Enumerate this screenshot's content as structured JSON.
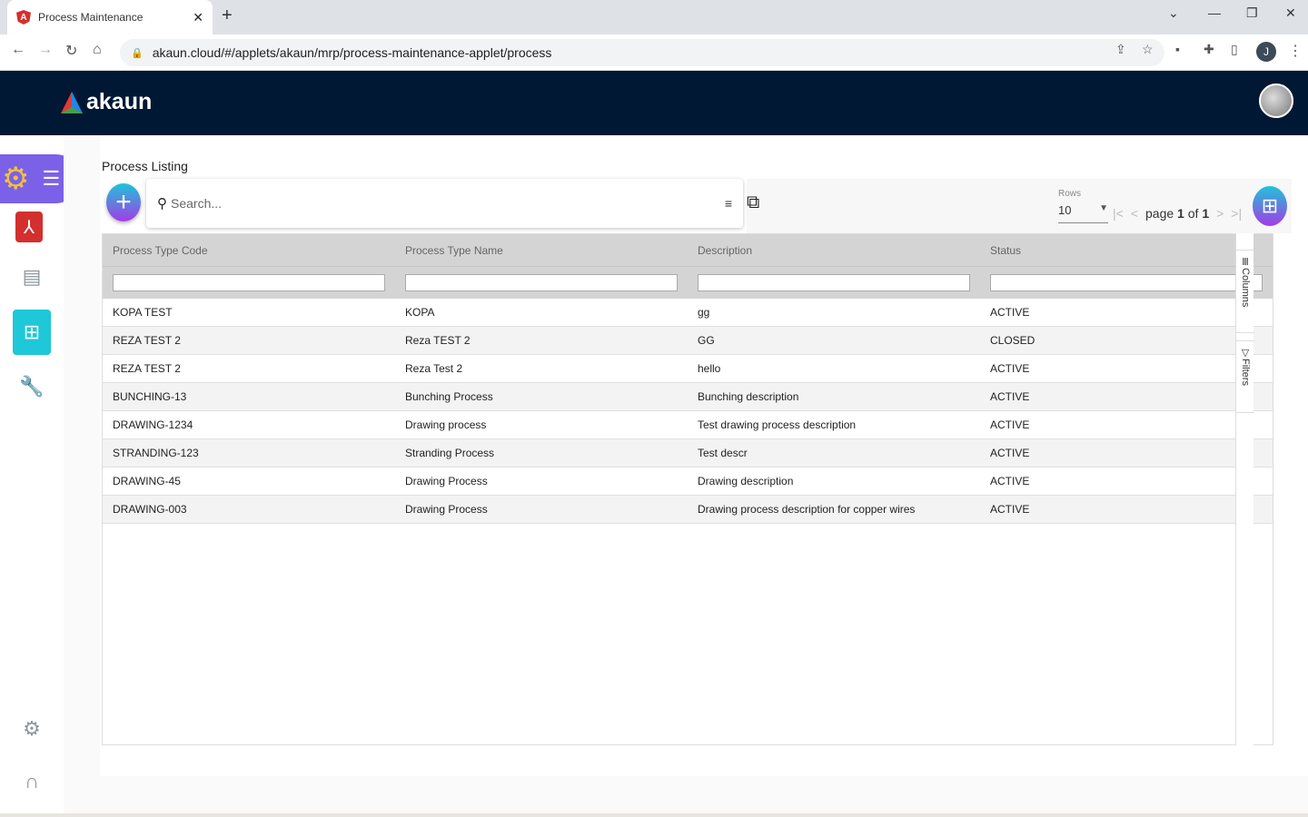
{
  "browser": {
    "tab_title": "Process Maintenance",
    "url": "akaun.cloud/#/applets/akaun/mrp/process-maintenance-applet/process",
    "profile_initial": "J"
  },
  "app": {
    "logo_text": "akaun"
  },
  "page": {
    "title": "Process Listing",
    "search_placeholder": "Search...",
    "rows_label": "Rows",
    "rows_value": "10",
    "page_word": "page",
    "page_current": "1",
    "of_word": "of",
    "page_total": "1"
  },
  "side_tabs": {
    "columns": "Columns",
    "filters": "Filters"
  },
  "table": {
    "columns": [
      "Process Type Code",
      "Process Type Name",
      "Description",
      "Status"
    ],
    "rows": [
      [
        "KOPA TEST",
        "KOPA",
        "gg",
        "ACTIVE"
      ],
      [
        "REZA TEST 2",
        "Reza TEST 2",
        "GG",
        "CLOSED"
      ],
      [
        "REZA TEST 2",
        "Reza Test 2",
        "hello",
        "ACTIVE"
      ],
      [
        "BUNCHING-13",
        "Bunching Process",
        "Bunching description",
        "ACTIVE"
      ],
      [
        "DRAWING-1234",
        "Drawing process",
        "Test drawing process description",
        "ACTIVE"
      ],
      [
        "STRANDING-123",
        "Stranding Process",
        "Test descr",
        "ACTIVE"
      ],
      [
        "DRAWING-45",
        "Drawing Process",
        "Drawing description",
        "ACTIVE"
      ],
      [
        "DRAWING-003",
        "Drawing Process",
        "Drawing process description for copper wires",
        "ACTIVE"
      ]
    ]
  }
}
